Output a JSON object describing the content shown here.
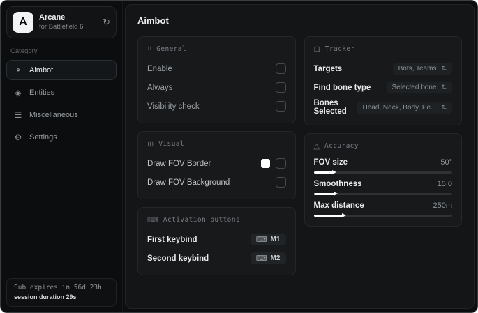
{
  "app": {
    "name": "Arcane",
    "subtitle": "for Battlefield 6",
    "logo_letter": "A",
    "sync_icon": "↻"
  },
  "sidebar": {
    "category_label": "Category",
    "items": [
      {
        "label": "Aimbot",
        "icon": "⌖"
      },
      {
        "label": "Entities",
        "icon": "◈"
      },
      {
        "label": "Miscellaneous",
        "icon": "☰"
      },
      {
        "label": "Settings",
        "icon": "⚙"
      }
    ],
    "status": {
      "line1": "Sub expires in 56d 23h",
      "line2": "session duration 29s"
    }
  },
  "main": {
    "title": "Aimbot",
    "cards": {
      "general": {
        "icon": "⌗",
        "title": "General",
        "rows": [
          {
            "label": "Enable",
            "checked": false
          },
          {
            "label": "Always",
            "checked": false
          },
          {
            "label": "Visibility check",
            "checked": false
          }
        ]
      },
      "visual": {
        "icon": "⊞",
        "title": "Visual",
        "rows": [
          {
            "label": "Draw FOV Border",
            "checked": false,
            "swatch_color": "#ffffff",
            "swatch_style": "background:#ffffff"
          },
          {
            "label": "Draw FOV Background",
            "checked": false
          }
        ]
      },
      "activation": {
        "icon": "⌨",
        "title": "Activation buttons",
        "key_icon": "⌨",
        "rows": [
          {
            "label": "First keybind",
            "key": "M1"
          },
          {
            "label": "Second keybind",
            "key": "M2"
          }
        ]
      },
      "tracker": {
        "icon": "⊟",
        "title": "Tracker",
        "expand_icon": "⇅",
        "rows": [
          {
            "label": "Targets",
            "value": "Bots, Teams"
          },
          {
            "label": "Find bone type",
            "value": "Selected bone"
          },
          {
            "label": "Bones Selected",
            "value": "Head, Neck, Body, Pe..."
          }
        ]
      },
      "accuracy": {
        "icon": "△",
        "title": "Accuracy",
        "sliders": [
          {
            "label": "FOV size",
            "value": "50°",
            "percent": 14,
            "fill_style": "width:14%"
          },
          {
            "label": "Smoothness",
            "value": "15.0",
            "percent": 15,
            "fill_style": "width:15%"
          },
          {
            "label": "Max distance",
            "value": "250m",
            "percent": 21,
            "fill_style": "width:21%"
          }
        ]
      }
    }
  },
  "colors": {
    "accent_swatch": "#ffffff",
    "window_bg": "#0b0d0e",
    "card_bg": "#17191b"
  }
}
